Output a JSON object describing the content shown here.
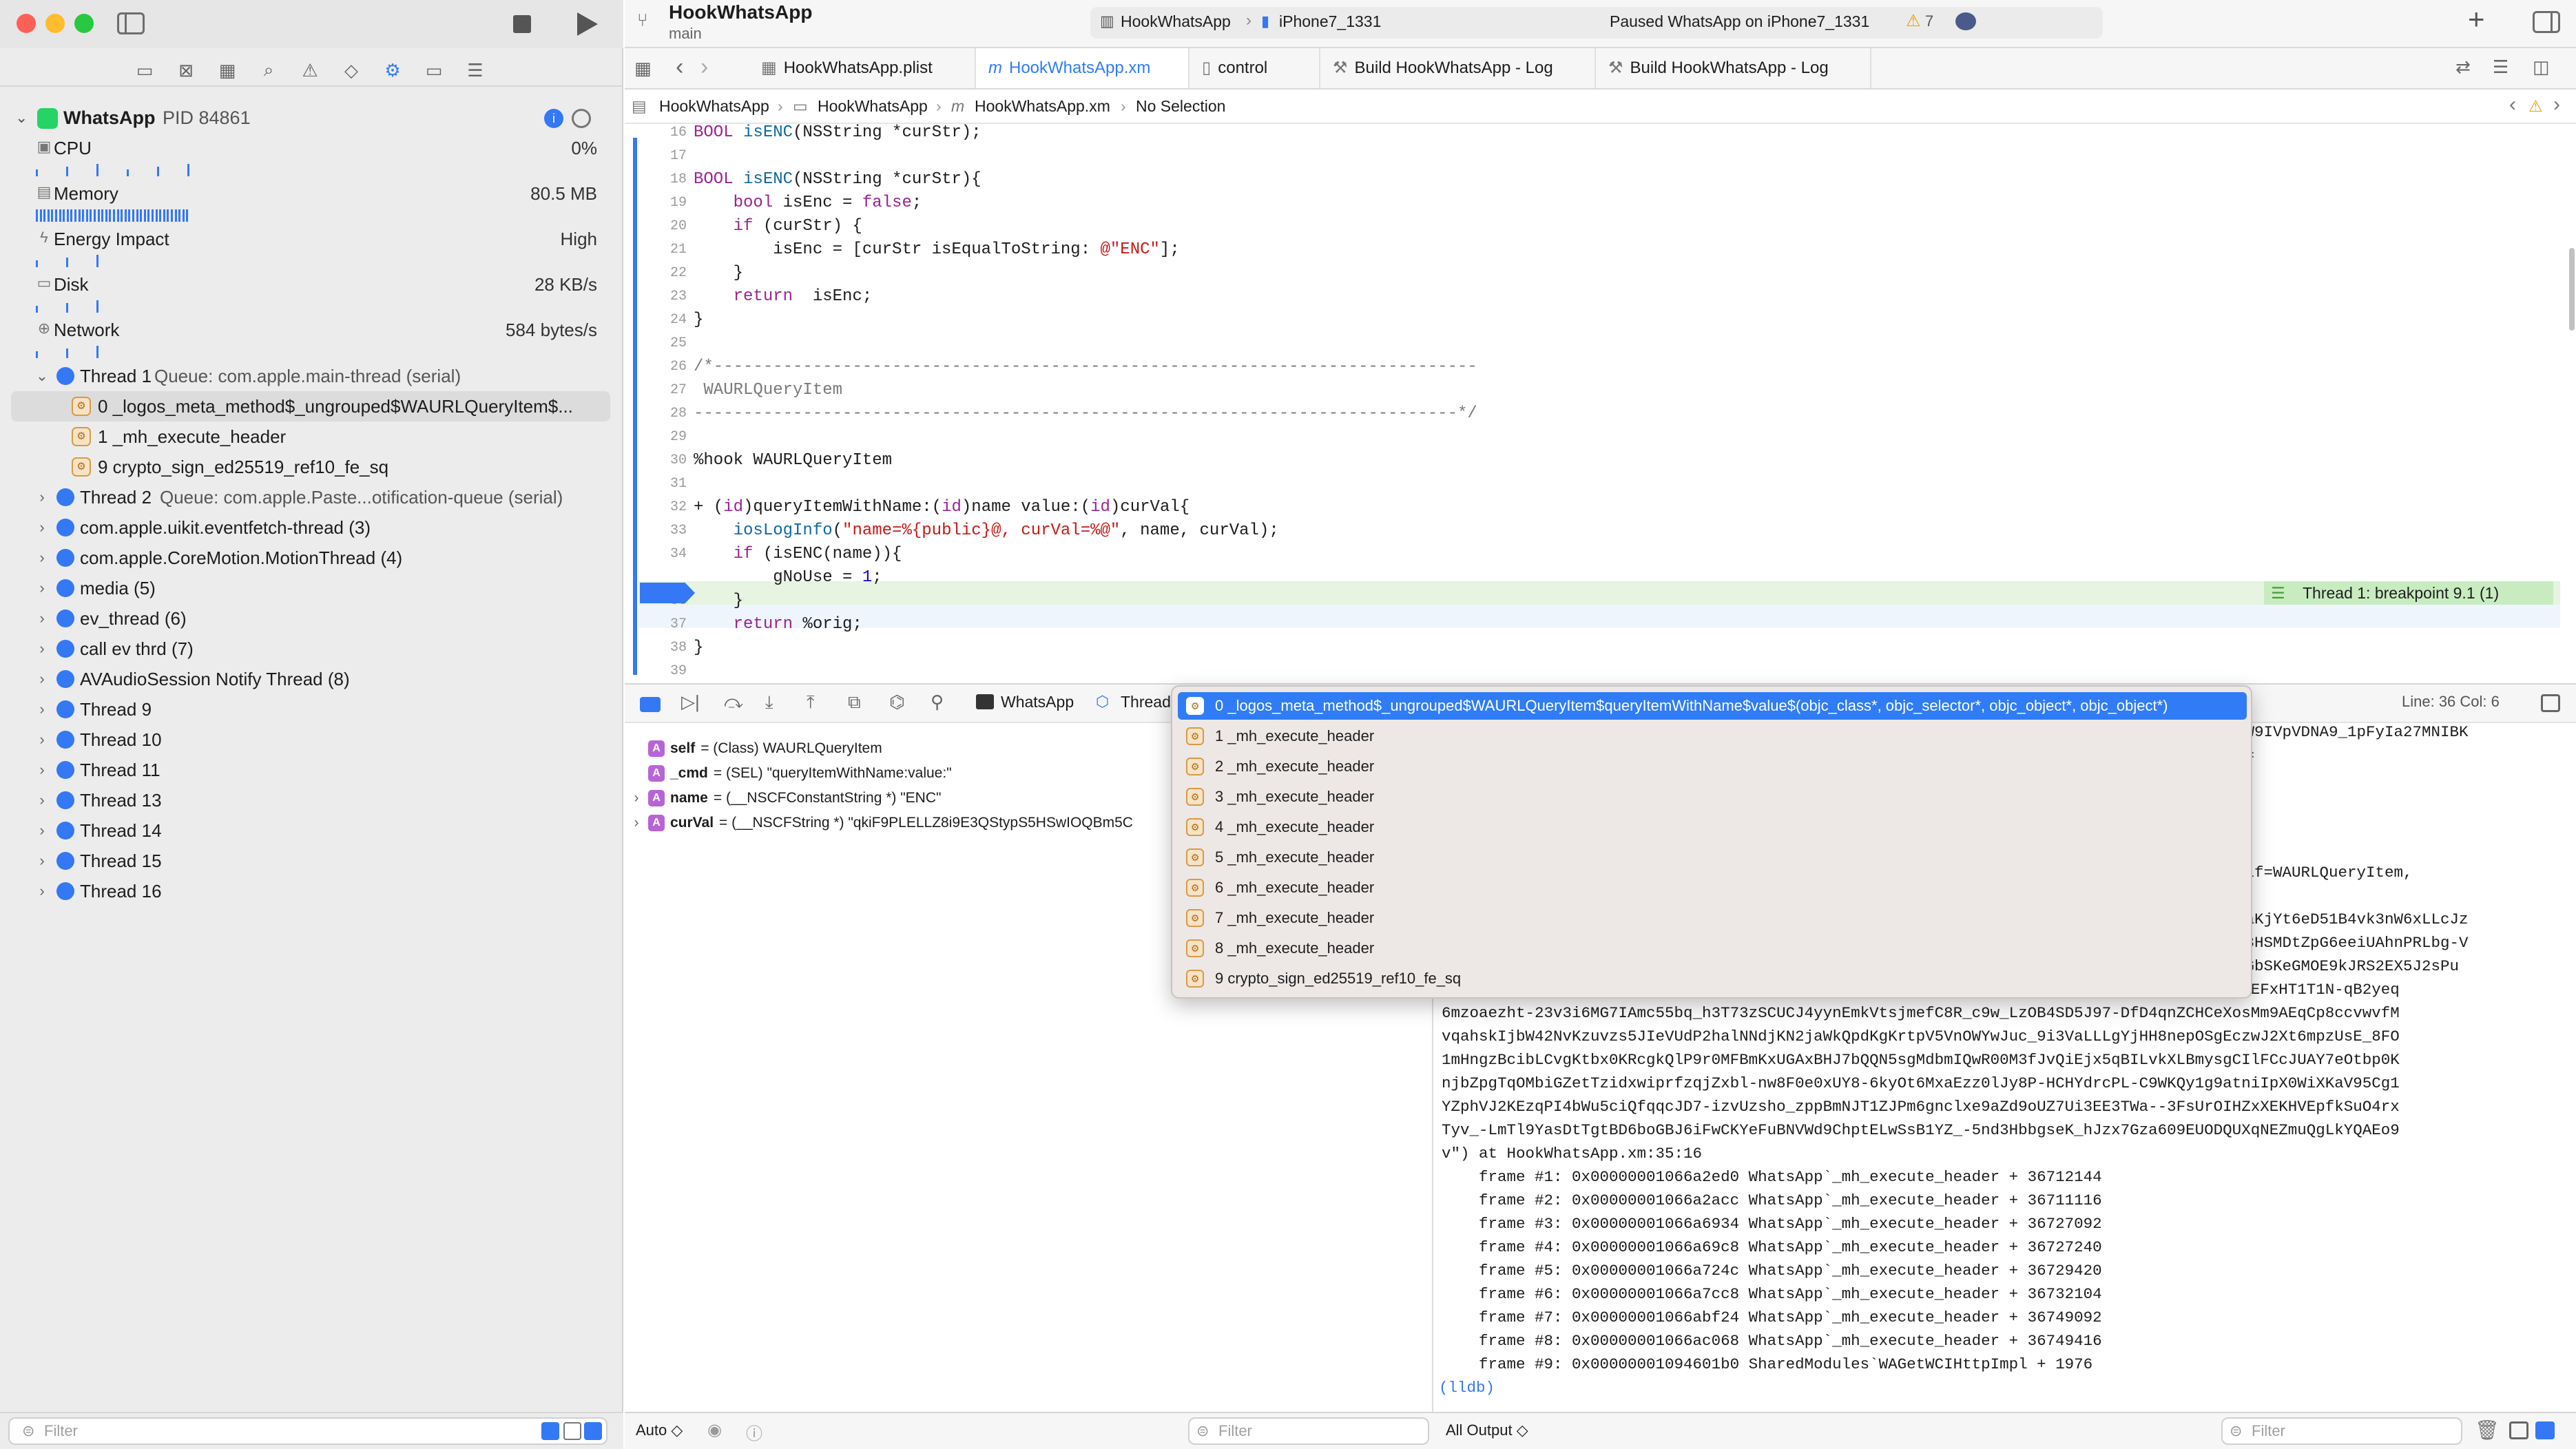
{
  "window": {
    "project": "HookWhatsApp",
    "branch": "main",
    "scheme": "HookWhatsApp",
    "device": "iPhone7_1331",
    "status": "Paused WhatsApp on iPhone7_1331",
    "warnings": "7"
  },
  "process": {
    "name": "WhatsApp",
    "pid": "PID 84861"
  },
  "gauges": [
    {
      "label": "CPU",
      "value": "0%",
      "icon": "cpu-icon"
    },
    {
      "label": "Memory",
      "value": "80.5 MB",
      "icon": "memory-icon"
    },
    {
      "label": "Energy Impact",
      "value": "High",
      "icon": "bolt-icon"
    },
    {
      "label": "Disk",
      "value": "28 KB/s",
      "icon": "disk-icon"
    },
    {
      "label": "Network",
      "value": "584 bytes/s",
      "icon": "globe-icon"
    }
  ],
  "threads": [
    {
      "label": "Thread 1",
      "sub": "Queue: com.apple.main-thread (serial)",
      "expanded": true
    },
    {
      "label": "0 _logos_meta_method$_ungrouped$WAURLQueryItem$...",
      "frame": true,
      "selected": true
    },
    {
      "label": "1 _mh_execute_header",
      "frame": true
    },
    {
      "label": "9 crypto_sign_ed25519_ref10_fe_sq",
      "frame": true
    },
    {
      "label": "Thread 2",
      "sub": "Queue: com.apple.Paste...otification-queue (serial)"
    },
    {
      "label": "com.apple.uikit.eventfetch-thread (3)"
    },
    {
      "label": "com.apple.CoreMotion.MotionThread (4)"
    },
    {
      "label": "media (5)"
    },
    {
      "label": "ev_thread (6)"
    },
    {
      "label": "call ev thrd (7)"
    },
    {
      "label": "AVAudioSession Notify Thread (8)"
    },
    {
      "label": "Thread 9"
    },
    {
      "label": "Thread 10"
    },
    {
      "label": "Thread 11"
    },
    {
      "label": "Thread 13"
    },
    {
      "label": "Thread 14"
    },
    {
      "label": "Thread 15"
    },
    {
      "label": "Thread 16"
    }
  ],
  "left_filter_placeholder": "Filter",
  "tabs": [
    {
      "label": "HookWhatsApp.plist"
    },
    {
      "label": "HookWhatsApp.xm"
    },
    {
      "label": "control"
    },
    {
      "label": "Build HookWhatsApp - Log"
    },
    {
      "label": "Build HookWhatsApp - Log"
    }
  ],
  "breadcrumb": [
    "HookWhatsApp",
    "HookWhatsApp",
    "HookWhatsApp.xm",
    "No Selection"
  ],
  "code_lines": [
    {
      "n": "16",
      "html": "<span class=\"kw\">BOOL</span> <span class=\"fn\">isENC</span>(NSString *curStr);"
    },
    {
      "n": "17",
      "html": ""
    },
    {
      "n": "18",
      "html": "<span class=\"kw\">BOOL</span> <span class=\"fn\">isENC</span>(NSString *curStr){"
    },
    {
      "n": "19",
      "html": "    <span class=\"kw\">bool</span> isEnc = <span class=\"kw\">false</span>;"
    },
    {
      "n": "20",
      "html": "    <span class=\"kw\">if</span> (curStr) {"
    },
    {
      "n": "21",
      "html": "        isEnc = [curStr isEqualToString: <span class=\"str\">@\"ENC\"</span>];"
    },
    {
      "n": "22",
      "html": "    }"
    },
    {
      "n": "23",
      "html": "    <span class=\"kw\">return</span>  isEnc;"
    },
    {
      "n": "24",
      "html": "}"
    },
    {
      "n": "25",
      "html": ""
    },
    {
      "n": "26",
      "html": "<span class=\"cm\">/*-----------------------------------------------------------------------------</span>"
    },
    {
      "n": "27",
      "html": "<span class=\"cm\"> WAURLQueryItem</span>"
    },
    {
      "n": "28",
      "html": "<span class=\"cm\">-----------------------------------------------------------------------------*/</span>"
    },
    {
      "n": "29",
      "html": ""
    },
    {
      "n": "30",
      "html": "%hook WAURLQueryItem"
    },
    {
      "n": "31",
      "html": ""
    },
    {
      "n": "32",
      "html": "+ (<span class=\"kw\">id</span>)queryItemWithName:(<span class=\"kw\">id</span>)name value:(<span class=\"kw\">id</span>)curVal{"
    },
    {
      "n": "33",
      "html": "    <span class=\"fn\">iosLogInfo</span>(<span class=\"str\">\"name=%{public}@, curVal=%@\"</span>, name, curVal);"
    },
    {
      "n": "34",
      "html": "    <span class=\"kw\">if</span> (isENC(name)){"
    },
    {
      "n": "35",
      "html": "        gNoUse = <span class=\"num\">1</span>;"
    },
    {
      "n": "36",
      "html": "    }"
    },
    {
      "n": "37",
      "html": "    <span class=\"kw\">return</span> %orig;"
    },
    {
      "n": "38",
      "html": "}"
    },
    {
      "n": "39",
      "html": ""
    }
  ],
  "breakpoint_banner": "Thread 1: breakpoint 9.1 (1)",
  "debug": {
    "process": "WhatsApp",
    "thread": "Thread",
    "position": "Line: 36  Col: 6"
  },
  "variables": [
    {
      "name": "self",
      "value": "= (Class) WAURLQueryItem",
      "expandable": false
    },
    {
      "name": "_cmd",
      "value": "= (SEL) \"queryItemWithName:value:\"",
      "expandable": false
    },
    {
      "name": "name",
      "value": "= (__NSCFConstantString *) \"ENC\"",
      "expandable": true
    },
    {
      "name": "curVal",
      "value": "= (__NSCFString *) \"qkiF9PLELLZ8i9E3QStypS5HSwIOQBm5C",
      "expandable": true
    }
  ],
  "popup_items": [
    "0 _logos_meta_method$_ungrouped$WAURLQueryItem$queryItemWithName$value$(objc_class*, objc_selector*, objc_object*, objc_object*)",
    "1 _mh_execute_header",
    "2 _mh_execute_header",
    "3 _mh_execute_header",
    "4 _mh_execute_header",
    "5 _mh_execute_header",
    "6 _mh_execute_header",
    "7 _mh_execute_header",
    "8 _mh_execute_header",
    "9 crypto_sign_ed25519_ref10_fe_sq"
  ],
  "console_lines": [
    "m4BSVW9IVpVDNA9_1pFyIa27MNIBK",
    "qafCs=",
    "",
    "",
    "",
    "",
    "e$(self=WAURLQueryItem,",
    "",
    "FEerHaKjYt6eD51B4vk3nW6xLLcJz",
    "jAYC83HSMDtZpG6eeiUAhnPRLbg-V",
    "c3R3wGbSKeGMOE9kJRS2EX5J2sPu",
    "ELzsWHe9YWxWbJJte1b5OZb23fLxg4WafXeDqRK0JmBI00feqDHgQkAxd_Qf_qwNjRT8vRrxKI4fjETkoyK8BqeEFxHT1T1N-qB2yeq",
    "6mzoaezht-23v3i6MG7IAmc55bq_h3T73zSCUCJ4yynEmkVtsjmefC8R_c9w_LzOB4SD5J97-DfD4qnZCHCeXosMm9AEqCp8ccvwvfM",
    "vqahskIjbW42NvKzuvzs5JIeVUdP2halNNdjKN2jaWkQpdKgKrtpV5VnOWYwJuc_9i3VaLLLgYjHH8nepOSgEczwJ2Xt6mpzUsE_8FO",
    "1mHngzBcibLCvgKtbx0KRcgkQlP9r0MFBmKxUGAxBHJ7bQQN5sgMdbmIQwR00M3fJvQiEjx5qBILvkXLBmysgCIlFCcJUAY7eOtbp0K",
    "njbZpgTqOMbiGZetTzidxwiprfzqjZxbl-nw8F0e0xUY8-6kyOt6MxaEzz0lJy8P-HCHYdrcPL-C9WKQy1g9atniIpX0WiXKaV95Cg1",
    "YZphVJ2KEzqPI4bWu5ciQfqqcJD7-izvUzsho_zppBmNJT1ZJPm6gnclxe9aZd9oUZ7Ui3EE3TWa--3FsUrOIHZxXEKHVEpfkSuO4rx",
    "Tyv_-LmTl9YasDtTgtBD6boGBJ6iFwCKYeFuBNVWd9ChptELwSsB1YZ_-5nd3HbbgseK_hJzx7Gza609EUODQUXqNEZmuQgLkYQAEo9",
    "v\") at HookWhatsApp.xm:35:16",
    "    frame #1: 0x00000001066a2ed0 WhatsApp`_mh_execute_header + 36712144",
    "    frame #2: 0x00000001066a2acc WhatsApp`_mh_execute_header + 36711116",
    "    frame #3: 0x00000001066a6934 WhatsApp`_mh_execute_header + 36727092",
    "    frame #4: 0x00000001066a69c8 WhatsApp`_mh_execute_header + 36727240",
    "    frame #5: 0x00000001066a724c WhatsApp`_mh_execute_header + 36729420",
    "    frame #6: 0x00000001066a7cc8 WhatsApp`_mh_execute_header + 36732104",
    "    frame #7: 0x00000001066abf24 WhatsApp`_mh_execute_header + 36749092",
    "    frame #8: 0x00000001066ac068 WhatsApp`_mh_execute_header + 36749416",
    "    frame #9: 0x00000001094601b0 SharedModules`WAGetWCIHttpImpl + 1976",
    "(lldb)"
  ],
  "bottom": {
    "auto": "Auto ◇",
    "filter": "Filter",
    "output": "All Output ◇",
    "console_filter": "Filter"
  },
  "colors": {
    "accent": "#2f7cf6",
    "breakpoint": "#3478f6",
    "highlight_line": "#e6f4e1",
    "banner": "#c8ecc0"
  }
}
